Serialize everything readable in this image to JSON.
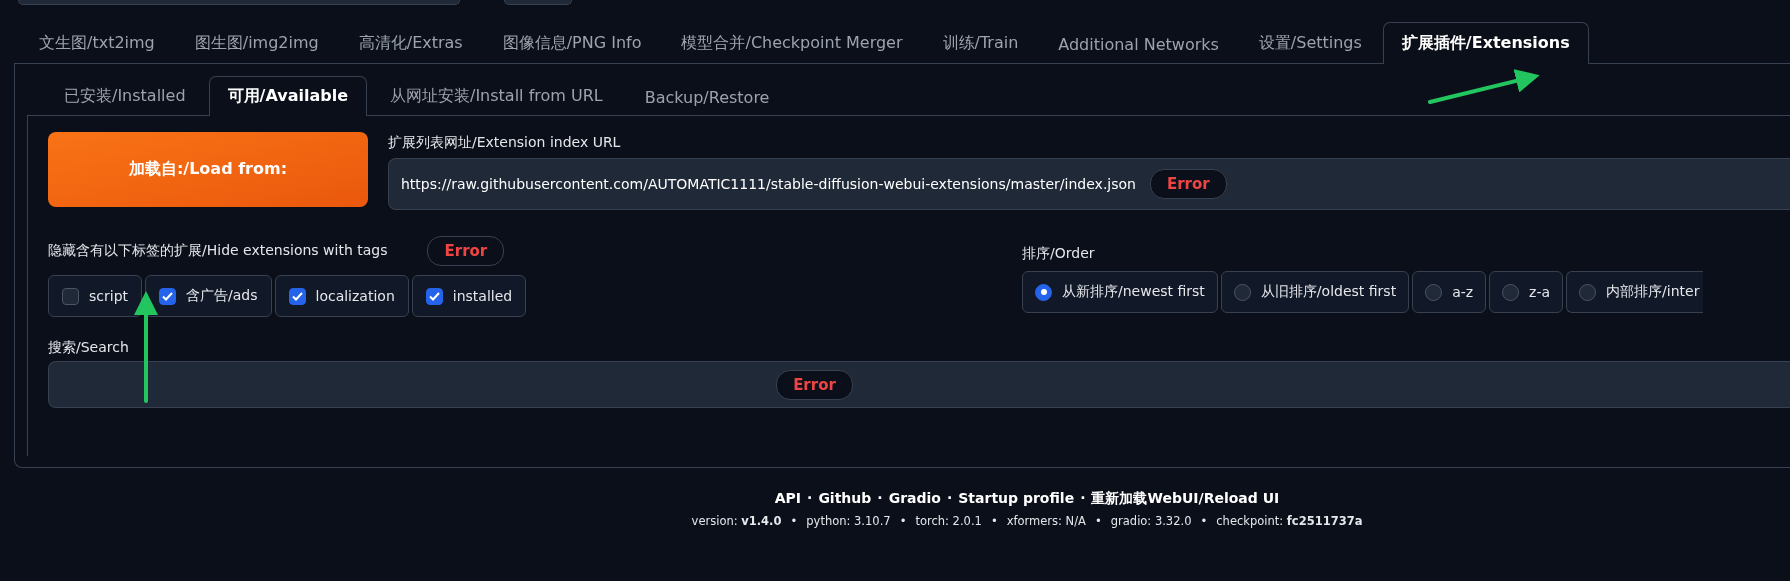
{
  "main_tabs": [
    {
      "label": "文生图/txt2img",
      "selected": false
    },
    {
      "label": "图生图/img2img",
      "selected": false
    },
    {
      "label": "高清化/Extras",
      "selected": false
    },
    {
      "label": "图像信息/PNG Info",
      "selected": false
    },
    {
      "label": "模型合并/Checkpoint Merger",
      "selected": false
    },
    {
      "label": "训练/Train",
      "selected": false
    },
    {
      "label": "Additional Networks",
      "selected": false
    },
    {
      "label": "设置/Settings",
      "selected": false
    },
    {
      "label": "扩展插件/Extensions",
      "selected": true
    }
  ],
  "sub_tabs": [
    {
      "label": "已安装/Installed",
      "selected": false
    },
    {
      "label": "可用/Available",
      "selected": true
    },
    {
      "label": "从网址安装/Install from URL",
      "selected": false
    },
    {
      "label": "Backup/Restore",
      "selected": false
    }
  ],
  "load_button": "加载自:/Load from:",
  "index_url": {
    "label": "扩展列表网址/Extension index URL",
    "value": "https://raw.githubusercontent.com/AUTOMATIC1111/stable-diffusion-webui-extensions/master/index.json",
    "error": "Error"
  },
  "hide_tags": {
    "label": "隐藏含有以下标签的扩展/Hide extensions with tags",
    "error": "Error",
    "options": [
      {
        "label": "script",
        "checked": false
      },
      {
        "label": "含广告/ads",
        "checked": true
      },
      {
        "label": "localization",
        "checked": true
      },
      {
        "label": "installed",
        "checked": true
      }
    ]
  },
  "order": {
    "label": "排序/Order",
    "options": [
      {
        "label": "从新排序/newest first",
        "selected": true
      },
      {
        "label": "从旧排序/oldest first",
        "selected": false
      },
      {
        "label": "a-z",
        "selected": false
      },
      {
        "label": "z-a",
        "selected": false
      },
      {
        "label": "内部排序/inter",
        "selected": false
      }
    ]
  },
  "search": {
    "label": "搜索/Search",
    "error": "Error"
  },
  "footer": {
    "separator": "·",
    "links": [
      "API",
      "Github",
      "Gradio",
      "Startup profile",
      "重新加载WebUI/Reload UI"
    ],
    "bullet": "•",
    "versions": [
      "version: **v1.4.0**",
      "python: 3.10.7",
      "torch: 2.0.1",
      "xformers: N/A",
      "gradio: 3.32.0",
      "checkpoint: **fc2511737a**"
    ]
  }
}
